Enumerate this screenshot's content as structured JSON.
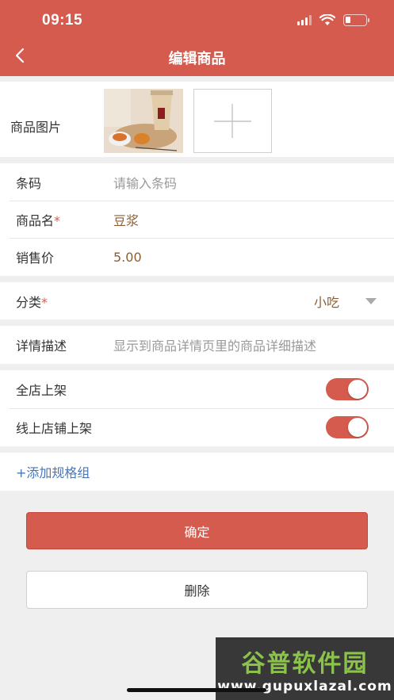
{
  "status_bar": {
    "time": "09:15",
    "battery_level": 0.25
  },
  "nav": {
    "title": "编辑商品"
  },
  "image_section": {
    "label": "商品图片"
  },
  "form": {
    "barcode": {
      "label": "条码",
      "placeholder": "请输入条码"
    },
    "name": {
      "label": "商品名",
      "required_mark": "*",
      "value": "豆浆"
    },
    "price": {
      "label": "销售价",
      "value": "5.00"
    },
    "category": {
      "label": "分类",
      "required_mark": "*",
      "value": "小吃"
    },
    "description": {
      "label": "详情描述",
      "placeholder": "显示到商品详情页里的商品详细描述"
    },
    "store_listing": {
      "label": "全店上架",
      "on": true
    },
    "online_listing": {
      "label": "线上店铺上架",
      "on": true
    },
    "add_spec_group": {
      "label": "+添加规格组"
    }
  },
  "actions": {
    "confirm_label": "确定",
    "delete_label": "删除"
  },
  "watermark": {
    "title": "谷普软件园",
    "url": "www.gupuxlazal.com"
  },
  "colors": {
    "accent": "#d45b4d",
    "link": "#4a77b4",
    "value_brown": "#8b5e34"
  }
}
